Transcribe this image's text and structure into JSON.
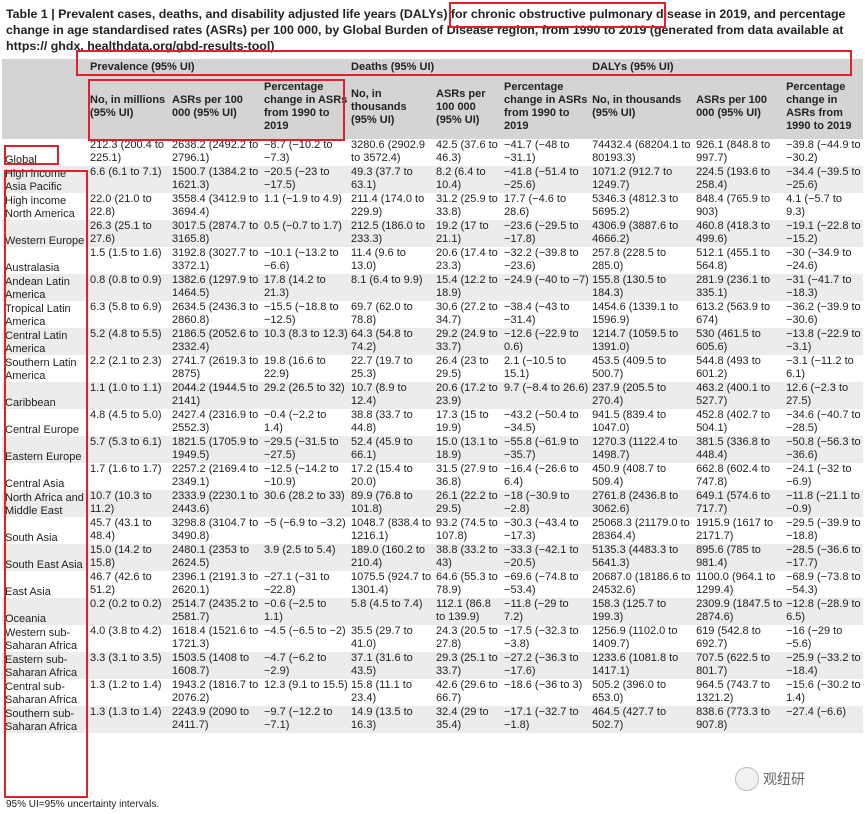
{
  "title": "Table 1 | Prevalent cases, deaths, and disability adjusted life years (DALYs) for chronic obstructive pulmonary disease in 2019, and percentage change in age standardised rates (ASRs) per 100 000, by Global Burden of Disease region, from 1990 to 2019 (generated from data available at https:// ghdx. healthdata.org/gbd-results-tool)",
  "groups": [
    "Prevalence (95% UI)",
    "Deaths (95% UI)",
    "DALYs (95% UI)"
  ],
  "subheaders": [
    "No, in millions (95% UI)",
    "ASRs per 100 000 (95% UI)",
    "Percentage change in ASRs from 1990 to 2019",
    "No, in thousands (95% UI)",
    "ASRs per 100 000 (95% UI)",
    "Percentage change in ASRs from 1990 to 2019",
    "No, in thousands (95% UI)",
    "ASRs per 100 000 (95% UI)",
    "Percentage change in ASRs from 1990 to 2019"
  ],
  "rows": [
    {
      "region": "Global",
      "cells": [
        "212.3 (200.4 to 225.1)",
        "2638.2 (2492.2 to 2796.1)",
        "−8.7 (−10.2 to −7.3)",
        "3280.6 (2902.9 to 3572.4)",
        "42.5 (37.6 to 46.3)",
        "−41.7 (−48 to −31.1)",
        "74432.4 (68204.1 to 80193.3)",
        "926.1 (848.8 to 997.7)",
        "−39.8 (−44.9 to −30.2)"
      ]
    },
    {
      "region": "High income Asia Pacific",
      "cells": [
        "6.6 (6.1 to 7.1)",
        "1500.7 (1384.2 to 1621.3)",
        "−20.5 (−23 to −17.5)",
        "49.3 (37.7 to 63.1)",
        "8.2 (6.4 to 10.4)",
        "−41.8 (−51.4 to −25.6)",
        "1071.2 (912.7 to 1249.7)",
        "224.5 (193.6 to 258.4)",
        "−34.4 (−39.5 to −25.6)"
      ]
    },
    {
      "region": "High income North America",
      "cells": [
        "22.0 (21.0 to 22.8)",
        "3558.4 (3412.9 to 3694.4)",
        "1.1 (−1.9 to 4.9)",
        "211.4 (174.0 to 229.9)",
        "31.2 (25.9 to 33.8)",
        "17.7 (−4.6 to 28.6)",
        "5346.3 (4812.3 to 5695.2)",
        "848.4 (765.9 to 903)",
        "4.1 (−5.7 to 9.3)"
      ]
    },
    {
      "region": "Western Europe",
      "cells": [
        "26.3 (25.1 to 27.6)",
        "3017.5 (2874.7 to 3165.8)",
        "0.5 (−0.7 to 1.7)",
        "212.5 (186.0 to 233.3)",
        "19.2 (17 to 21.1)",
        "−23.6 (−29.5 to −17.8)",
        "4306.9 (3887.6 to 4666.2)",
        "460.8 (418.3 to 499.6)",
        "−19.1 (−22.8 to −15.2)"
      ]
    },
    {
      "region": "Australasia",
      "cells": [
        "1.5 (1.5 to 1.6)",
        "3192.8 (3027.7 to 3372.1)",
        "−10.1 (−13.2 to −6.6)",
        "11.4 (9.6 to 13.0)",
        "20.6 (17.4 to 23.3)",
        "−32.2 (−39.8 to −23.6)",
        "257.8 (228.5 to 285.0)",
        "512.1 (455.1 to 564.8)",
        "−30 (−34.9 to −24.6)"
      ]
    },
    {
      "region": "Andean Latin America",
      "cells": [
        "0.8 (0.8 to 0.9)",
        "1382.6 (1297.9 to 1464.5)",
        "17.8 (14.2 to 21.3)",
        "8.1 (6.4 to 9.9)",
        "15.4 (12.2 to 18.9)",
        "−24.9 (−40 to −7)",
        "155.8 (130.5 to 184.3)",
        "281.9 (236.1 to 335.1)",
        "−31 (−41.7 to −18.3)"
      ]
    },
    {
      "region": "Tropical Latin America",
      "cells": [
        "6.3 (5.8 to 6.9)",
        "2634.5 (2436.3 to 2860.8)",
        "−15.5 (−18.8 to −12.5)",
        "69.7 (62.0 to 78.8)",
        "30.6 (27.2 to 34.7)",
        "−38.4 (−43 to −31.4)",
        "1454.6 (1339.1 to 1596.9)",
        "613.2 (563.9 to 674)",
        "−36.2 (−39.9 to −30.6)"
      ]
    },
    {
      "region": "Central Latin America",
      "cells": [
        "5.2 (4.8 to 5.5)",
        "2186.5 (2052.6 to 2332.4)",
        "10.3 (8.3 to 12.3)",
        "64.3 (54.8 to 74.2)",
        "29.2 (24.9 to 33.7)",
        "−12.6 (−22.9 to 0.6)",
        "1214.7 (1059.5 to 1391.0)",
        "530 (461.5 to 605.6)",
        "−13.8 (−22.9 to −3.1)"
      ]
    },
    {
      "region": "Southern Latin America",
      "cells": [
        "2.2 (2.1 to 2.3)",
        "2741.7 (2619.3 to 2875)",
        "19.8 (16.6 to 22.9)",
        "22.7 (19.7 to 25.3)",
        "26.4 (23 to 29.5)",
        "2.1 (−10.5 to 15.1)",
        "453.5 (409.5 to 500.7)",
        "544.8 (493 to 601.2)",
        "−3.1 (−11.2 to 6.1)"
      ]
    },
    {
      "region": "Caribbean",
      "cells": [
        "1.1 (1.0 to 1.1)",
        "2044.2 (1944.5 to 2141)",
        "29.2 (26.5 to 32)",
        "10.7 (8.9 to 12.4)",
        "20.6 (17.2 to 23.9)",
        "9.7 (−8.4 to 26.6)",
        "237.9 (205.5 to 270.4)",
        "463.2 (400.1 to 527.7)",
        "12.6 (−2.3 to 27.5)"
      ]
    },
    {
      "region": "Central Europe",
      "cells": [
        "4.8 (4.5 to 5.0)",
        "2427.4 (2316.9 to 2552.3)",
        "−0.4 (−2.2 to 1.4)",
        "38.8 (33.7 to 44.8)",
        "17.3 (15 to 19.9)",
        "−43.2 (−50.4 to −34.5)",
        "941.5 (839.4 to 1047.0)",
        "452.8 (402.7 to 504.1)",
        "−34.6 (−40.7 to −28.5)"
      ]
    },
    {
      "region": "Eastern Europe",
      "cells": [
        "5.7 (5.3 to 6.1)",
        "1821.5 (1705.9 to 1949.5)",
        "−29.5 (−31.5 to −27.5)",
        "52.4 (45.9 to 66.1)",
        "15.0 (13.1 to 18.9)",
        "−55.8 (−61.9 to −35.7)",
        "1270.3 (1122.4 to 1498.7)",
        "381.5 (336.8 to 448.4)",
        "−50.8 (−56.3 to −36.6)"
      ]
    },
    {
      "region": "Central Asia",
      "cells": [
        "1.7 (1.6 to 1.7)",
        "2257.2 (2169.4 to 2349.1)",
        "−12.5 (−14.2 to −10.9)",
        "17.2 (15.4 to 20.0)",
        "31.5 (27.9 to 36.8)",
        "−16.4 (−26.6 to 6.4)",
        "450.9 (408.7 to 509.4)",
        "662.8 (602.4 to 747.8)",
        "−24.1 (−32 to −6.9)"
      ]
    },
    {
      "region": "North Africa and Middle East",
      "cells": [
        "10.7 (10.3 to 11.2)",
        "2333.9 (2230.1 to 2443.6)",
        "30.6 (28.2 to 33)",
        "89.9 (76.8 to 101.8)",
        "26.1 (22.2 to 29.5)",
        "−18 (−30.9 to −2.8)",
        "2761.8 (2436.8 to 3062.6)",
        "649.1 (574.6 to 717.7)",
        "−11.8 (−21.1 to −0.9)"
      ]
    },
    {
      "region": "South Asia",
      "cells": [
        "45.7 (43.1 to 48.4)",
        "3298.8 (3104.7 to 3490.8)",
        "−5 (−6.9 to −3.2)",
        "1048.7 (838.4 to 1216.1)",
        "93.2 (74.5 to 107.8)",
        "−30.3 (−43.4 to −17.3)",
        "25068.3 (21179.0 to 28364.4)",
        "1915.9 (1617 to 2171.7)",
        "−29.5 (−39.9 to −18.8)"
      ]
    },
    {
      "region": "South East Asia",
      "cells": [
        "15.0 (14.2 to 15.8)",
        "2480.1 (2353 to 2624.5)",
        "3.9 (2.5 to 5.4)",
        "189.0 (160.2 to 210.4)",
        "38.8 (33.2 to 43)",
        "−33.3 (−42.1 to −20.5)",
        "5135.3 (4483.3 to 5641.3)",
        "895.6 (785 to 981.4)",
        "−28.5 (−36.6 to −17.7)"
      ]
    },
    {
      "region": "East Asia",
      "cells": [
        "46.7 (42.6 to 51.2)",
        "2396.1 (2191.3 to 2620.1)",
        "−27.1 (−31 to −22.8)",
        "1075.5 (924.7 to 1301.4)",
        "64.6 (55.3 to 78.9)",
        "−69.6 (−74.8 to −53.4)",
        "20687.0 (18186.6 to 24532.6)",
        "1100.0 (964.1 to 1299.4)",
        "−68.9 (−73.8 to −54.3)"
      ]
    },
    {
      "region": "Oceania",
      "cells": [
        "0.2 (0.2 to 0.2)",
        "2514.7 (2435.2 to 2581.7)",
        "−0.6 (−2.5 to 1.1)",
        "5.8 (4.5 to 7.4)",
        "112.1 (86.8 to 139.9)",
        "−11.8 (−29 to 7.2)",
        "158.3 (125.7 to 199.3)",
        "2309.9 (1847.5 to 2874.6)",
        "−12.8 (−28.9 to 6.5)"
      ]
    },
    {
      "region": "Western sub-Saharan Africa",
      "cells": [
        "4.0 (3.8 to 4.2)",
        "1618.4 (1521.6 to 1721.3)",
        "−4.5 (−6.5 to −2)",
        "35.5 (29.7 to 41.0)",
        "24.3 (20.5 to 27.8)",
        "−17.5 (−32.3 to −3.8)",
        "1256.9 (1102.0 to 1409.7)",
        "619 (542.8 to 692.7)",
        "−16 (−29 to −5.6)"
      ]
    },
    {
      "region": "Eastern sub-Saharan Africa",
      "cells": [
        "3.3 (3.1 to 3.5)",
        "1503.5 (1408 to 1608.7)",
        "−4.7 (−6.2 to −2.9)",
        "37.1 (31.6 to 43.5)",
        "29.3 (25.1 to 33.7)",
        "−27.2 (−36.3 to −17.6)",
        "1233.6 (1081.8 to 1417.1)",
        "707.5 (622.5 to 801.7)",
        "−25.9 (−33.2 to −18.4)"
      ]
    },
    {
      "region": "Central sub-Saharan Africa",
      "cells": [
        "1.3 (1.2 to 1.4)",
        "1943.2 (1816.7 to 2076.2)",
        "12.3 (9.1 to 15.5)",
        "15.8 (11.1 to 23.4)",
        "42.6 (29.6 to 66.7)",
        "−18.6 (−36 to 3)",
        "505.2 (396.0 to 653.0)",
        "964.5 (743.7 to 1321.2)",
        "−15.6 (−30.2 to 1.4)"
      ]
    },
    {
      "region": "Southern sub-Saharan Africa",
      "cells": [
        "1.3 (1.3 to 1.4)",
        "2243.9 (2090 to 2411.7)",
        "−9.7 (−12.2 to −7.1)",
        "14.9 (13.5 to 16.3)",
        "32.4 (29 to 35.4)",
        "−17.1 (−32.7 to −1.8)",
        "464.5 (427.7 to 502.7)",
        "838.6 (773.3 to 907.8)",
        "−27.4 (−6.6)"
      ]
    }
  ],
  "footnote": "95% UI=95% uncertainty intervals.",
  "watermark": "观纽研",
  "highlight_color": "#e0202a"
}
